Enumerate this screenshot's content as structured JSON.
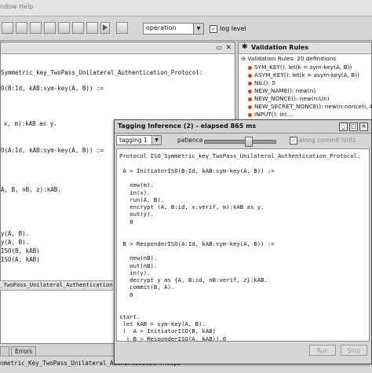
{
  "menubar": {
    "items": [
      "ndow",
      "Help"
    ]
  },
  "toolbar": {
    "mode_value": "operation",
    "log_level_checked": true,
    "log_level_label": "log level"
  },
  "editor": {
    "lines": [
      "Symmetric_key_TwoPass_Unilateral_Authentication_Protocol:",
      "O(B:Id, kAB:sym-key(A, B)) :=",
      "x, m):kAB as y.",
      "O(A:Id, kAB:sym-key(A, B)) :=",
      "A, B, nB, z):kAB.",
      "y(A, B).",
      "y(A, B).",
      "ISO(B, kAB)",
      "ISO(A, kAB)"
    ],
    "status_file": "_TwoPass_Unilateral_Authentication.RoSpi"
  },
  "validation": {
    "title": "Validation Rules",
    "summary": "Validation Rules: 20 definitions",
    "rules": [
      "SYM_KEY(): let(k = sym-key(A, B))",
      "ASYM_KEY(): let(k = asym-key(A, B))",
      "NIL(): 0",
      "NEW_NAME(): new(n)",
      "NEW_NONCE(): new(n:Un)",
      "NEW_SECRET_NONCE(): new(n:nonce(i, A, B",
      "INPUT(): in(..."
    ]
  },
  "tagging": {
    "title": "Tagging Inference (2) - elapsed 865 ms",
    "select_value": "tagging 1",
    "patience_label": "patience",
    "patience_level": 0.62,
    "commit_hints_label": "along commit hints",
    "commit_hints_checked": true,
    "code": [
      "Protocol ISO_Symmetric_key_TwoPass_Unilateral_Authentication_Protocol:",
      "",
      " A > InitiatorISO(B:Id, kAB:sym-key(A, B)) :=",
      "",
      "   new(m).",
      "   in(x).",
      "   run(A, B).",
      "   encrypt (A, B:id, x:verif, m):kAB as y.",
      "   out(y).",
      "   0",
      "",
      "",
      " B > ResponderISO(A:Id, kAB:sym-key(A, B)) :=",
      "",
      "   new(nB).",
      "   out(nB).",
      "   in(y).",
      "   decrypt y as {A, B:id, nB:verif, z}:kAB.",
      "   commit(B, A).",
      "   0",
      "",
      "",
      "start.",
      " let kAB = sym-key(A, B).",
      " (  A > InitiatorISO(B, kAB)",
      "  | B > ResponderISO(A, kAB)).0"
    ],
    "run_label": "Run",
    "stop_label": "Stop"
  },
  "bottom": {
    "tab_errors": "Errors",
    "status": "nmetric_Key_TwoPass_Unilateral_Authentication.RoSpi"
  },
  "colors": {
    "rule_bullet": "#c84a1c",
    "accent_red": "#b02020"
  }
}
